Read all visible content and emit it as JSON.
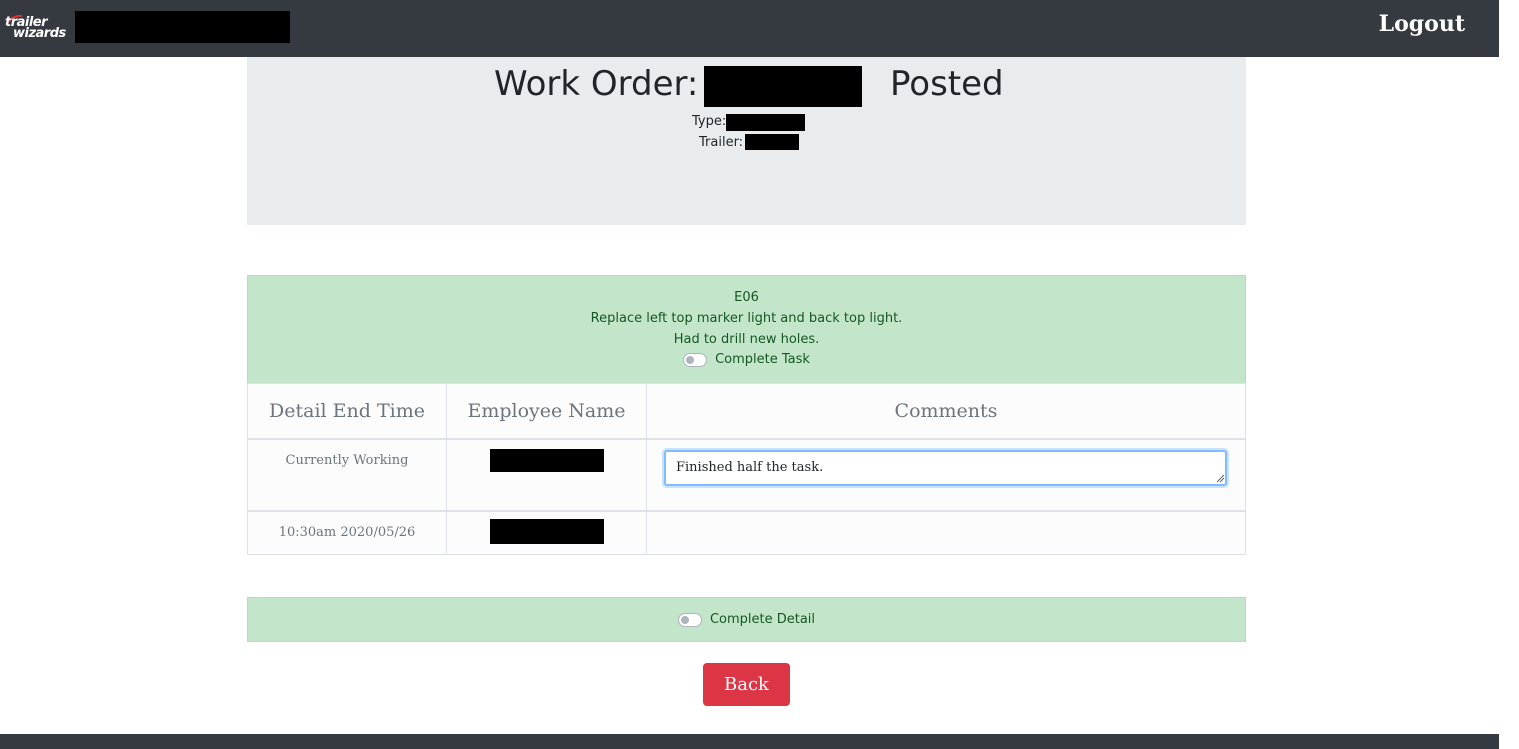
{
  "header": {
    "logo_line1": "trailer",
    "logo_line2": "wizards",
    "logout_label": "Logout"
  },
  "work_order": {
    "title_label": "Work Order:",
    "status": "Posted",
    "type_label": "Type:",
    "trailer_label": "Trailer:"
  },
  "task": {
    "code": "E06",
    "description": "Replace left top marker light and back top light.",
    "note": "Had to drill new holes.",
    "complete_label": "Complete Task",
    "complete_checked": false
  },
  "table": {
    "headers": [
      "Detail End Time",
      "Employee Name",
      "Comments"
    ],
    "rows": [
      {
        "end_time": "Currently Working",
        "comment_value": "Finished half the task."
      },
      {
        "end_time": "10:30am 2020/05/26",
        "comment_value": ""
      }
    ]
  },
  "detail": {
    "complete_label": "Complete Detail",
    "complete_checked": false
  },
  "actions": {
    "back_label": "Back"
  },
  "colors": {
    "navbar": "#343a40",
    "jumbotron": "#e9ecef",
    "success_bg": "#c3e6cb",
    "success_text": "#155724",
    "danger": "#dc3545"
  }
}
